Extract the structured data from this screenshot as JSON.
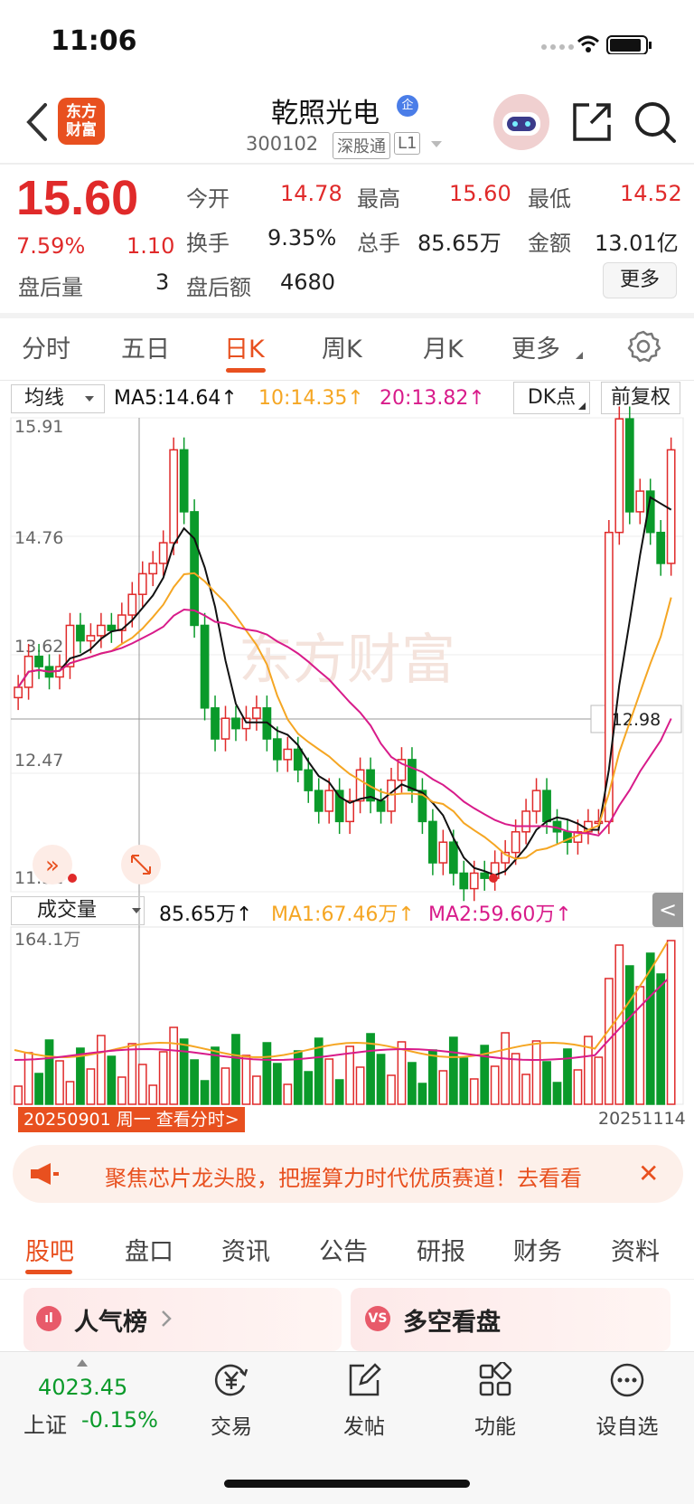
{
  "status_bar": {
    "time": "11:06"
  },
  "header": {
    "logo_text": "东方财富",
    "title": "乾照光电",
    "badge": "企",
    "code": "300102",
    "tag1": "深股通",
    "tag2": "L1"
  },
  "quote": {
    "price": "15.60",
    "change_pct": "7.59%",
    "change": "1.10",
    "rows": [
      [
        {
          "label": "今开",
          "value": "14.78",
          "color": "#e02a2a"
        },
        {
          "label": "最高",
          "value": "15.60",
          "color": "#e02a2a"
        },
        {
          "label": "最低",
          "value": "14.52",
          "color": "#e02a2a"
        }
      ],
      [
        {
          "label": "换手",
          "value": "9.35%",
          "color": "#222222"
        },
        {
          "label": "总手",
          "value": "85.65万",
          "color": "#222222"
        },
        {
          "label": "金额",
          "value": "13.01亿",
          "color": "#222222"
        }
      ]
    ],
    "after_vol_label": "盘后量",
    "after_vol": "3",
    "after_amt_label": "盘后额",
    "after_amt": "4680",
    "more": "更多"
  },
  "period_tabs": [
    "分时",
    "五日",
    "日K",
    "周K",
    "月K",
    "更多"
  ],
  "ma_row": {
    "select": "均线",
    "ma5": "MA5:14.64↑",
    "ma10": "10:14.35↑",
    "ma20": "20:13.82↑",
    "dk": "DK点",
    "fq": "前复权"
  },
  "price_axis": [
    "15.91",
    "14.76",
    "13.62",
    "12.47",
    "11.32"
  ],
  "crosshair_price": "12.98",
  "volume_row": {
    "select": "成交量",
    "vol": "85.65万↑",
    "ma1": "MA1:67.46万↑",
    "ma2": "MA2:59.60万↑",
    "collapse": "<",
    "axis_max": "164.1万"
  },
  "dates": {
    "left": "20250901 周一 查看分时>",
    "right": "20251114"
  },
  "banner": {
    "text": "聚焦芯片龙头股，把握算力时代优质赛道！去看看"
  },
  "bottom_tabs": [
    "股吧",
    "盘口",
    "资讯",
    "公告",
    "研报",
    "财务",
    "资料"
  ],
  "cards": [
    {
      "icon": "ıl",
      "label": "人气榜"
    },
    {
      "icon": "VS",
      "label": "多空看盘"
    }
  ],
  "index": {
    "value": "4023.45",
    "name": "上证",
    "pct": "-0.15%"
  },
  "nav": [
    "交易",
    "发帖",
    "功能",
    "设自选"
  ],
  "colors": {
    "up": "#e02a2a",
    "down": "#0a9a2a",
    "accent": "#e8501f",
    "ma5": "#111111",
    "ma10": "#f5a623",
    "ma20": "#d81b8a"
  }
}
